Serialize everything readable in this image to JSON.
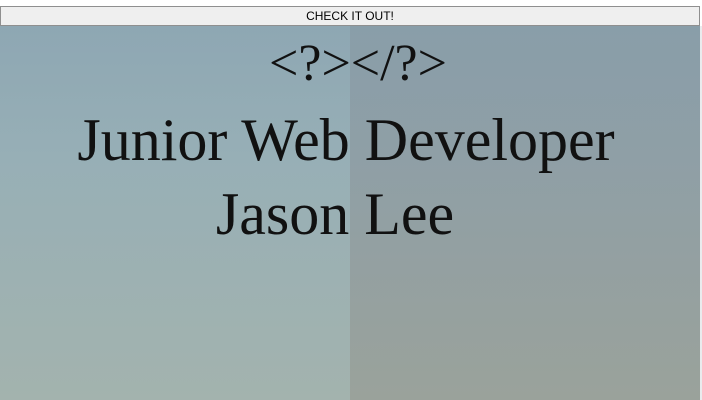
{
  "header": {
    "button_label": "CHECK IT OUT!"
  },
  "hero": {
    "logo_text": "<?></?>",
    "job_title": "Junior Web Developer",
    "name": "Jason Lee"
  },
  "colors": {
    "hero_sky_left": "#8ea7b3",
    "hero_sky_right": "#899ea9",
    "text": "#111111"
  }
}
